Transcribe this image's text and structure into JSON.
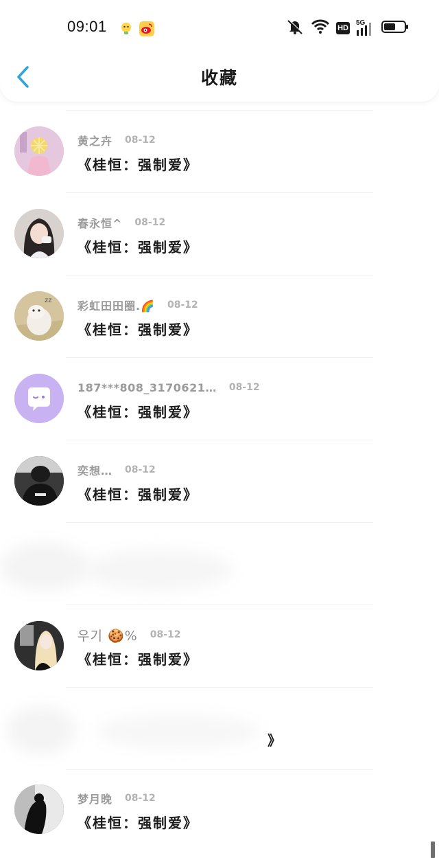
{
  "status_bar": {
    "time": "09:01",
    "network_label": "5G",
    "hd_label": "HD",
    "notification_icons": [
      "lightbulb-icon",
      "weibo-icon"
    ],
    "right_icons": [
      "bell-muted-icon",
      "wifi-icon",
      "hd-icon",
      "signal-5g-icon",
      "battery-icon"
    ]
  },
  "header": {
    "title": "收藏",
    "back_icon": "chevron-left-icon"
  },
  "items": [
    {
      "name": "黄之卉",
      "date": "08-12",
      "message": "《桂恒：强制爱》"
    },
    {
      "name": "春永恒^",
      "date": "08-12",
      "message": "《桂恒：强制爱》"
    },
    {
      "name": "彩虹田田圈.🌈",
      "date": "08-12",
      "message": "《桂恒：强制爱》"
    },
    {
      "name": "187***808_3170621…",
      "date": "08-12",
      "message": "《桂恒：强制爱》"
    },
    {
      "name": "奕想…",
      "date": "08-12",
      "message": "《桂恒：强制爱》"
    },
    {
      "name": "우기 🍪%",
      "date": "08-12",
      "message": "《桂恒：强制爱》"
    },
    {
      "name": "梦月晚",
      "date": "08-12",
      "message": "《桂恒：强制爱》"
    }
  ],
  "blurred_row_fragment": "》",
  "colors": {
    "accent": "#2ea3e0",
    "title_text": "#1a1a1a",
    "name_text": "#9a9a9a",
    "date_text": "#b3b3b3",
    "message_text": "#1c1c1c",
    "default_avatar_bg": "#c9b2f2"
  }
}
